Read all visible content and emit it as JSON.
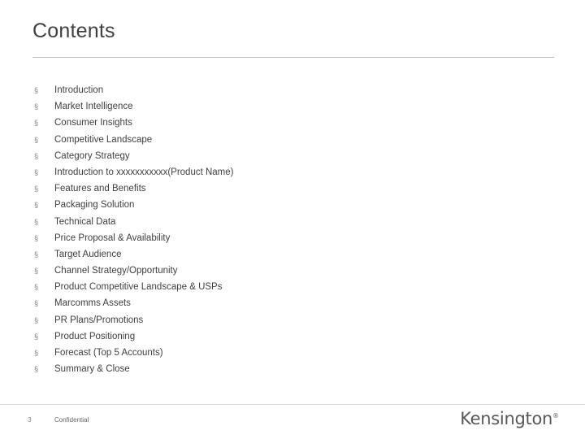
{
  "slide": {
    "title": "Contents",
    "bullet_char": "§",
    "items": [
      "Introduction",
      "Market Intelligence",
      "Consumer Insights",
      "Competitive Landscape",
      "Category Strategy",
      "Introduction to xxxxxxxxxxx(Product Name)",
      "Features and Benefits",
      "Packaging Solution",
      "Technical Data",
      "Price Proposal & Availability",
      "Target Audience",
      "Channel Strategy/Opportunity",
      "Product Competitive Landscape & USPs",
      "Marcomms Assets",
      "PR Plans/Promotions",
      "Product Positioning",
      "Forecast (Top 5 Accounts)",
      "Summary & Close"
    ]
  },
  "footer": {
    "page_number": "3",
    "confidential": "Confidential",
    "brand": "Kensington",
    "brand_mark": "®"
  },
  "colors": {
    "title": "#404040",
    "body_text": "#3f3f3f",
    "rule": "#b8b8b8",
    "brand": "#58585b"
  }
}
